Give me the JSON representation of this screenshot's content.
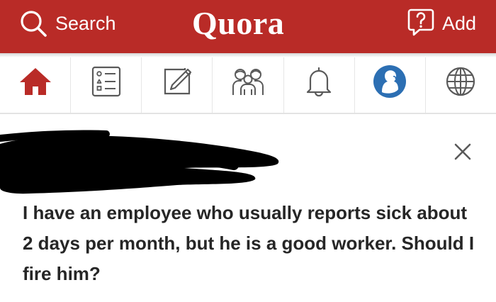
{
  "header": {
    "search_label": "Search",
    "logo": "Quora",
    "add_label": "Add",
    "background": "#b92b27",
    "icons": {
      "search": "search-icon",
      "add": "add-question-icon"
    }
  },
  "nav": {
    "active_color": "#b92b27",
    "inactive_color": "#5a5a5a",
    "items": [
      {
        "name": "home",
        "icon": "home-icon",
        "active": true
      },
      {
        "name": "answer",
        "icon": "answer-list-icon",
        "active": false
      },
      {
        "name": "write",
        "icon": "pencil-icon",
        "active": false
      },
      {
        "name": "spaces",
        "icon": "spaces-icon",
        "active": false
      },
      {
        "name": "notifications",
        "icon": "bell-icon",
        "active": false
      },
      {
        "name": "profile",
        "icon": "avatar-icon",
        "active": false
      },
      {
        "name": "languages",
        "icon": "globe-icon",
        "active": false
      }
    ]
  },
  "post": {
    "author": "redacted",
    "close_icon": "close-icon",
    "question": "I have an employee who usually reports sick about 2 days per month, but he is a good worker. Should I fire him?"
  }
}
